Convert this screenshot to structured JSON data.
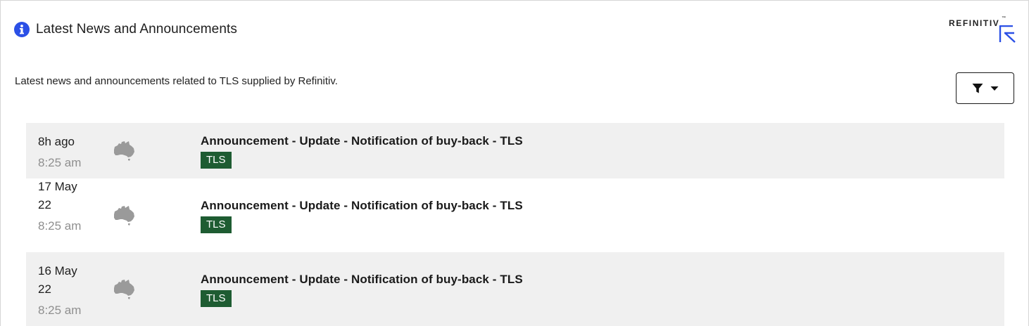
{
  "header": {
    "title": "Latest News and Announcements",
    "description": "Latest news and announcements related to TLS supplied by Refinitiv."
  },
  "logo": {
    "text": "REFINITIV",
    "trademark": "™",
    "accent_color": "#2b50e6"
  },
  "filter": {
    "icon": "filter-icon",
    "caret": "chevron-down-icon"
  },
  "news": [
    {
      "date": "8h ago",
      "time": "8:25 am",
      "region_icon": "australia-icon",
      "headline": "Announcement - Update - Notification of buy-back - TLS",
      "ticker": "TLS"
    },
    {
      "date": "17 May 22",
      "time": "8:25 am",
      "region_icon": "australia-icon",
      "headline": "Announcement - Update - Notification of buy-back - TLS",
      "ticker": "TLS"
    },
    {
      "date": "16 May 22",
      "time": "8:25 am",
      "region_icon": "australia-icon",
      "headline": "Announcement - Update - Notification of buy-back - TLS",
      "ticker": "TLS"
    }
  ],
  "colors": {
    "ticker_bg": "#1e5c32",
    "row_shade": "#f0f0f0",
    "info_icon": "#2b50e6",
    "muted_text": "#8f8f8f"
  }
}
